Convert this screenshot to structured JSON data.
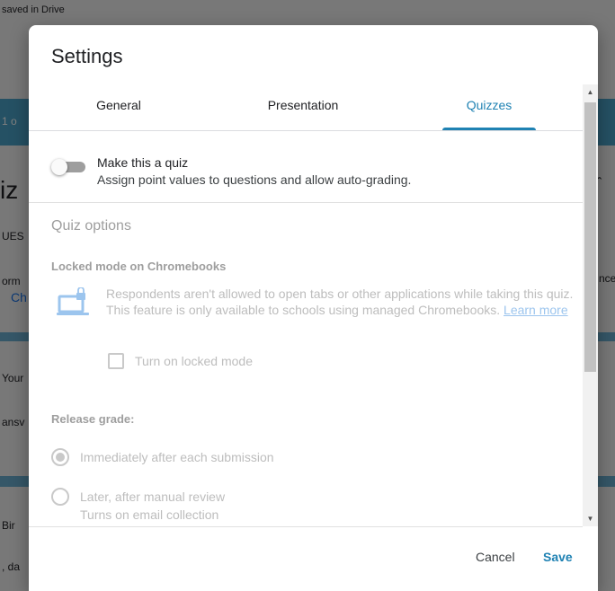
{
  "background": {
    "fragments": [
      "saved in Drive",
      "1 o",
      "iz",
      "UES",
      "orm",
      "Ch",
      "nce",
      "Your",
      "ansv",
      "Bir",
      ", da"
    ]
  },
  "dialog": {
    "title": "Settings",
    "tabs": [
      {
        "label": "General",
        "active": false
      },
      {
        "label": "Presentation",
        "active": false
      },
      {
        "label": "Quizzes",
        "active": true
      }
    ],
    "quiz_toggle": {
      "label": "Make this a quiz",
      "description": "Assign point values to questions and allow auto-grading.",
      "on": false
    },
    "quiz_options": {
      "title": "Quiz options",
      "locked_mode": {
        "label": "Locked mode on Chromebooks",
        "description": "Respondents aren't allowed to open tabs or other applications while taking this quiz. This feature is only available to schools using managed Chromebooks.",
        "learn_more": "Learn more",
        "checkbox_label": "Turn on locked mode",
        "checked": false
      },
      "release_grade": {
        "label": "Release grade:",
        "options": [
          {
            "label": "Immediately after each submission",
            "selected": true
          },
          {
            "label": "Later, after manual review",
            "sub": "Turns on email collection",
            "selected": false
          }
        ]
      }
    },
    "buttons": {
      "cancel": "Cancel",
      "save": "Save"
    }
  },
  "colors": {
    "accent": "#1f82b3",
    "disabled_text": "#bdbdbd",
    "link": "#9cc5ee"
  }
}
